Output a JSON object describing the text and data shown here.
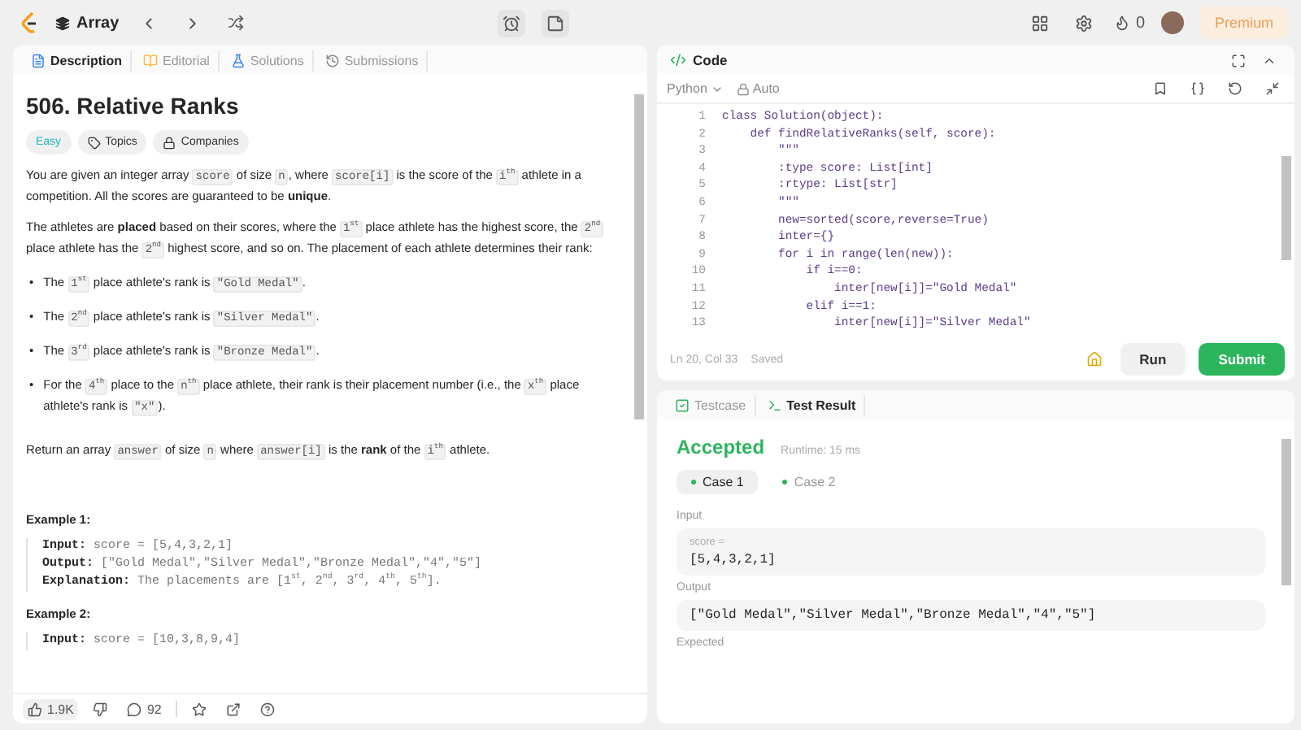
{
  "topbar": {
    "problem_list": "Array",
    "streak": "0",
    "premium": "Premium"
  },
  "description_tabs": [
    {
      "kind": "description",
      "label": "Description",
      "selected": true
    },
    {
      "kind": "editorial",
      "label": "Editorial",
      "selected": false
    },
    {
      "kind": "solutions",
      "label": "Solutions",
      "selected": false
    },
    {
      "kind": "submissions",
      "label": "Submissions",
      "selected": false
    }
  ],
  "problem": {
    "title": "506. Relative Ranks",
    "difficulty": "Easy",
    "tags": [
      {
        "kind": "topics",
        "label": "Topics"
      },
      {
        "kind": "companies",
        "label": "Companies"
      }
    ],
    "paragraphs": [
      [
        {
          "kind": "text",
          "text": "You are given an integer array "
        },
        {
          "kind": "code",
          "text": "score"
        },
        {
          "kind": "text",
          "text": " of size "
        },
        {
          "kind": "code",
          "text": "n"
        },
        {
          "kind": "text",
          "text": ", where "
        },
        {
          "kind": "code",
          "text": "score[i]"
        },
        {
          "kind": "text",
          "text": " is the score of the "
        },
        {
          "kind": "code",
          "text": "i$^{th}$"
        },
        {
          "kind": "text",
          "text": " athlete in a competition. All the scores are guaranteed to be **unique**."
        }
      ],
      [
        {
          "kind": "text",
          "text": "The athletes are **placed** based on their scores, where the "
        },
        {
          "kind": "code",
          "text": "1$^{st}$"
        },
        {
          "kind": "text",
          "text": " place athlete has the highest score, the "
        },
        {
          "kind": "code",
          "text": "2$^{nd}$"
        },
        {
          "kind": "text",
          "text": " place athlete has the "
        },
        {
          "kind": "code",
          "text": "2$^{nd}$"
        },
        {
          "kind": "text",
          "text": " highest score, and so on. The placement of each athlete determines their rank:"
        }
      ]
    ],
    "bullets": [
      {
        "marker": "•",
        "segments": [
          {
            "kind": "text",
            "text": "The "
          },
          {
            "kind": "code",
            "text": "1$^{st}$"
          },
          {
            "kind": "text",
            "text": " place athlete's rank is "
          },
          {
            "kind": "code",
            "text": "\"Gold Medal\""
          },
          {
            "kind": "text",
            "text": "."
          }
        ]
      },
      {
        "marker": "•",
        "segments": [
          {
            "kind": "text",
            "text": "The "
          },
          {
            "kind": "code",
            "text": "2$^{nd}$"
          },
          {
            "kind": "text",
            "text": " place athlete's rank is "
          },
          {
            "kind": "code",
            "text": "\"Silver Medal\""
          },
          {
            "kind": "text",
            "text": "."
          }
        ]
      },
      {
        "marker": "•",
        "segments": [
          {
            "kind": "text",
            "text": "The "
          },
          {
            "kind": "code",
            "text": "3$^{rd}$"
          },
          {
            "kind": "text",
            "text": " place athlete's rank is "
          },
          {
            "kind": "code",
            "text": "\"Bronze Medal\""
          },
          {
            "kind": "text",
            "text": "."
          }
        ]
      },
      {
        "marker": "•",
        "segments": [
          {
            "kind": "text",
            "text": "For the "
          },
          {
            "kind": "code",
            "text": "4$^{th}$"
          },
          {
            "kind": "text",
            "text": " place to the "
          },
          {
            "kind": "code",
            "text": "n$^{th}$"
          },
          {
            "kind": "text",
            "text": " place athlete, their rank is their placement number (i.e., the "
          },
          {
            "kind": "code",
            "text": "x$^{th}$"
          },
          {
            "kind": "text",
            "text": " place athlete's rank is "
          },
          {
            "kind": "code",
            "text": "\"x\""
          },
          {
            "kind": "text",
            "text": ")."
          }
        ]
      }
    ],
    "closing": [
      {
        "kind": "text",
        "text": "Return an array "
      },
      {
        "kind": "code",
        "text": "answer"
      },
      {
        "kind": "text",
        "text": " of size "
      },
      {
        "kind": "code",
        "text": "n"
      },
      {
        "kind": "text",
        "text": " where "
      },
      {
        "kind": "code",
        "text": "answer[i]"
      },
      {
        "kind": "text",
        "text": " is the **rank** of the "
      },
      {
        "kind": "code",
        "text": "i$^{th}$"
      },
      {
        "kind": "text",
        "text": " athlete."
      }
    ],
    "examples": [
      {
        "title": "Example 1:",
        "lines": [
          "**Input:** score = [5,4,3,2,1]",
          "**Output:** [\"Gold Medal\",\"Silver Medal\",\"Bronze Medal\",\"4\",\"5\"]",
          "**Explanation:** The placements are [1$^{st}$, 2$^{nd}$, 3$^{rd}$, 4$^{th}$, 5$^{th}$]."
        ]
      },
      {
        "title": "Example 2:",
        "lines": [
          "**Input:** score = [10,3,8,9,4]"
        ]
      }
    ]
  },
  "stats": {
    "likes": "1.9K",
    "comments": "92"
  },
  "code_panel": {
    "title": "Code",
    "language": "Python",
    "mode": "Auto",
    "lines": [
      {
        "n": "1",
        "code": "class Solution(object):"
      },
      {
        "n": "2",
        "code": "    def findRelativeRanks(self, score):"
      },
      {
        "n": "3",
        "code": "        \"\"\""
      },
      {
        "n": "4",
        "code": "        :type score: List[int]"
      },
      {
        "n": "5",
        "code": "        :rtype: List[str]"
      },
      {
        "n": "6",
        "code": "        \"\"\""
      },
      {
        "n": "7",
        "code": "        new=sorted(score,reverse=True)"
      },
      {
        "n": "8",
        "code": "        inter={}"
      },
      {
        "n": "9",
        "code": "        for i in range(len(new)):"
      },
      {
        "n": "10",
        "code": "            if i==0:"
      },
      {
        "n": "11",
        "code": "                inter[new[i]]=\"Gold Medal\""
      },
      {
        "n": "12",
        "code": "            elif i==1:"
      },
      {
        "n": "13",
        "code": "                inter[new[i]]=\"Silver Medal\""
      }
    ],
    "position": "Ln 20, Col 33",
    "save_state": "Saved",
    "run": "Run",
    "submit": "Submit"
  },
  "result_tabs": [
    {
      "kind": "testcase",
      "label": "Testcase",
      "selected": false
    },
    {
      "kind": "result",
      "label": "Test Result",
      "selected": true
    }
  ],
  "result": {
    "status": "Accepted",
    "runtime": "Runtime: 15 ms",
    "cases": [
      {
        "label": "Case 1",
        "selected": true
      },
      {
        "label": "Case 2",
        "selected": false
      }
    ],
    "input_label": "Input",
    "input_var": "score =",
    "input_value": "[5,4,3,2,1]",
    "output_label": "Output",
    "output_value": "[\"Gold Medal\",\"Silver Medal\",\"Bronze Medal\",\"4\",\"5\"]",
    "expected_label": "Expected"
  }
}
